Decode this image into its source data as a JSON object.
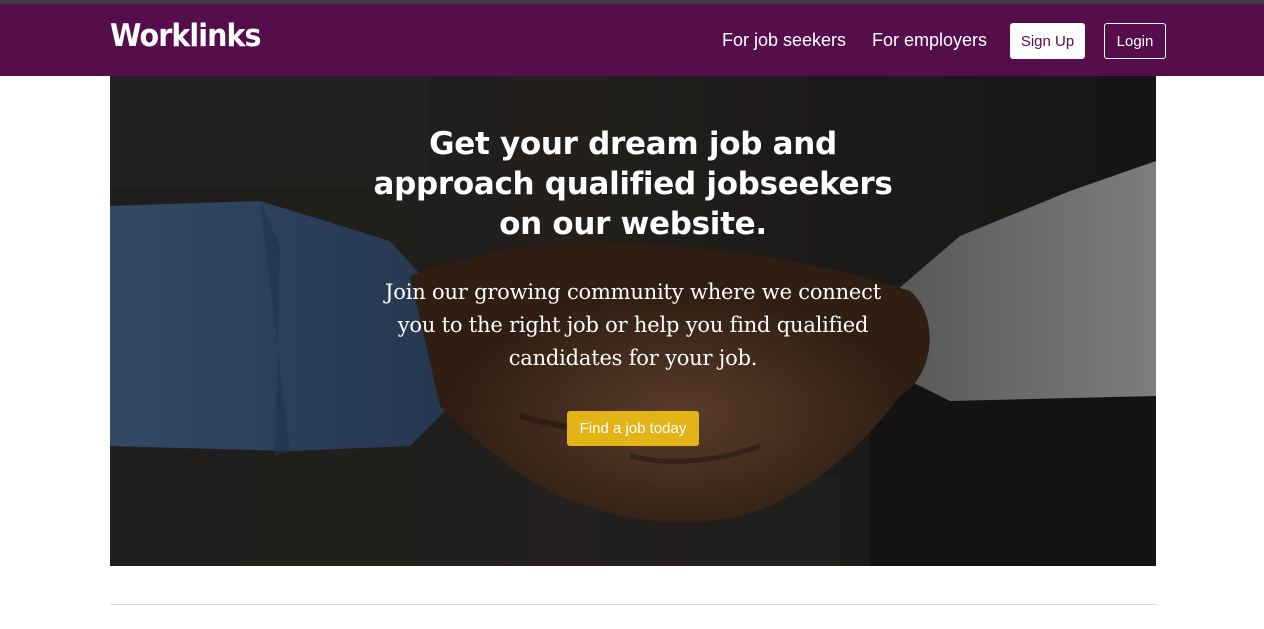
{
  "brand": {
    "logo_text": "Worklinks"
  },
  "nav": {
    "links": [
      "For job seekers",
      "For employers"
    ],
    "signup_label": "Sign Up",
    "login_label": "Login"
  },
  "hero": {
    "title_lines": [
      "Get your dream job and",
      "approach qualified jobseekers",
      "on our website."
    ],
    "subtitle_lines": [
      "Join our growing community where we connect",
      "you to the right job or help you find qualified",
      "candidates for your job."
    ],
    "cta_label": "Find a job today",
    "image_description_icon": "handshake-photo"
  },
  "colors": {
    "navbar_bg": "#560d4c",
    "cta_bg": "#e2b418",
    "text_light": "#ffffff"
  }
}
